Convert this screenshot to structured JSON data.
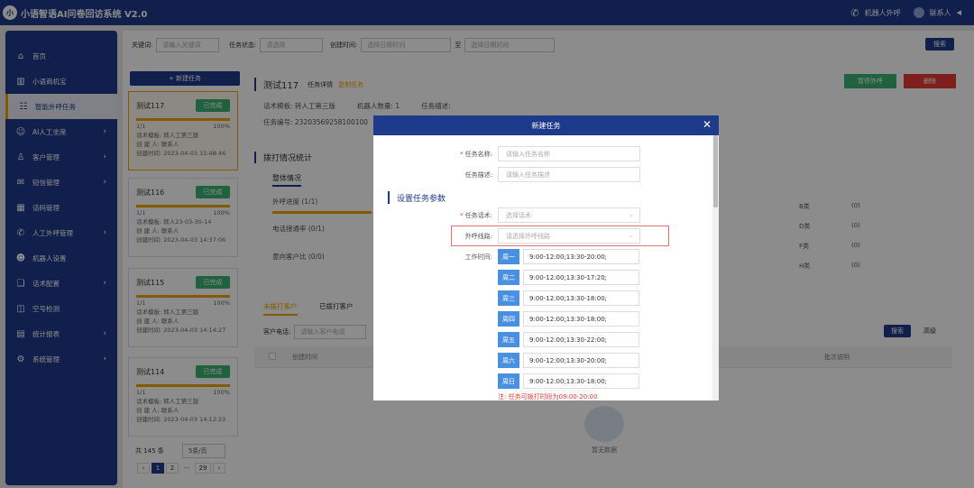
{
  "app": {
    "logo_text": "小",
    "title": "小语智语AI问卷回访系统 V2.0",
    "robot_call": "机器人外呼",
    "user": "联系人"
  },
  "sidebar": {
    "items": [
      {
        "label": "首页",
        "icon": "⌂",
        "arrow": ""
      },
      {
        "label": "小语商机宝",
        "icon": "▥",
        "arrow": ""
      },
      {
        "label": "智能外呼任务",
        "icon": "☷",
        "arrow": ""
      },
      {
        "label": "AI人工坐席",
        "icon": "☺",
        "arrow": "›"
      },
      {
        "label": "客户管理",
        "icon": "♙",
        "arrow": "›"
      },
      {
        "label": "短信管理",
        "icon": "✉",
        "arrow": "›"
      },
      {
        "label": "话码管理",
        "icon": "▦",
        "arrow": ""
      },
      {
        "label": "人工外呼管理",
        "icon": "✆",
        "arrow": "›"
      },
      {
        "label": "机器人设置",
        "icon": "☻",
        "arrow": ""
      },
      {
        "label": "话术配置",
        "icon": "❏",
        "arrow": "›"
      },
      {
        "label": "空号检测",
        "icon": "◫",
        "arrow": ""
      },
      {
        "label": "统计报表",
        "icon": "▤",
        "arrow": "›"
      },
      {
        "label": "系统管理",
        "icon": "⚙",
        "arrow": "›"
      }
    ]
  },
  "filters": {
    "keyword_label": "关键词:",
    "keyword_ph": "请输入关键词",
    "status_label": "任务状态:",
    "status_ph": "请选择",
    "time_label": "创建时间:",
    "start_ph": "选择日期时间",
    "to": "至",
    "end_ph": "选择日期时间",
    "search": "搜索"
  },
  "new_task": "+ 新建任务",
  "tasks": [
    {
      "name": "测试117",
      "status": "已完成",
      "count": "1/1",
      "pct": "100%",
      "tpl": "话术模板: 转人工第三版",
      "creator": "创 建 人: 联系人",
      "time": "创建时间: 2023-04-03 15:48:46"
    },
    {
      "name": "测试116",
      "status": "已完成",
      "count": "1/1",
      "pct": "100%",
      "tpl": "话术模板: 转人23-03-30-14",
      "creator": "创 建 人: 联系人",
      "time": "创建时间: 2023-04-03 14:37:06"
    },
    {
      "name": "测试115",
      "status": "已完成",
      "count": "1/1",
      "pct": "100%",
      "tpl": "话术模板: 转人工第三版",
      "creator": "创 建 人: 联系人",
      "time": "创建时间: 2023-04-03 14:14:27"
    },
    {
      "name": "测试114",
      "status": "已完成",
      "count": "1/1",
      "pct": "100%",
      "tpl": "话术模板: 转人工第三版",
      "creator": "创 建 人: 联系人",
      "time": "创建时间: 2023-04-03 14:12:23"
    }
  ],
  "pager": {
    "total": "共 145 条",
    "size": "5条/页",
    "pages": [
      "1",
      "2",
      "···",
      "29"
    ],
    "prev": "‹",
    "next": "›"
  },
  "detail": {
    "title": "测试117",
    "detail_link": "任务详情",
    "copy_link": "复制任务",
    "tpl": "话术模板: 转人工第三版",
    "robots": "机器人数量: 1",
    "desc": "任务描述:",
    "no": "任务编号: 23203569258100100",
    "btn1": "暂停外呼",
    "btn2": "删除"
  },
  "stats": {
    "title": "拨打情况统计",
    "tab": "整体情况",
    "rows": [
      "外呼进度 (1/1)",
      "电话接通率 (0/1)",
      "意向客户比 (0/0)"
    ],
    "grades": [
      {
        "k": "B类",
        "v": "(0)"
      },
      {
        "k": "D类",
        "v": "(0)"
      },
      {
        "k": "F类",
        "v": "(0)"
      },
      {
        "k": "H类",
        "v": "(0)"
      }
    ]
  },
  "customers": {
    "tab1": "未拨打客户",
    "tab2": "已拨打客户",
    "phone_label": "客户电话:",
    "phone_ph": "请输入客户电话",
    "search": "搜索",
    "advanced": "高级",
    "col1": "创建时间",
    "col2": "批次说明",
    "empty": "暂无数据"
  },
  "modal": {
    "title": "新建任务",
    "close": "✕",
    "name_label": "任务名称:",
    "name_ph": "请输入任务名称",
    "desc_label": "任务描述:",
    "desc_ph": "请输入任务描述",
    "section": "设置任务参数",
    "script_label": "任务话术:",
    "script_ph": "选择话术",
    "line_label": "外呼线路:",
    "line_ph": "请选择外呼线路",
    "time_label": "工作时间:",
    "days": [
      {
        "d": "周一",
        "v": "9:00-12:00;13:30-20:00;"
      },
      {
        "d": "周二",
        "v": "9:00-12:00;13:30-17:20;"
      },
      {
        "d": "周三",
        "v": "9:00-12:00;13:30-18:00;"
      },
      {
        "d": "周四",
        "v": "9:00-12:00;13:30-18:00;"
      },
      {
        "d": "周五",
        "v": "9:00-12:00;13:30-22:00;"
      },
      {
        "d": "周六",
        "v": "9:00-12:00;13:30-20:00;"
      },
      {
        "d": "周日",
        "v": "9:00-12:00;13:30-18:00;"
      }
    ],
    "note": "注: 任务可拨打时段为09:00-20:00"
  }
}
